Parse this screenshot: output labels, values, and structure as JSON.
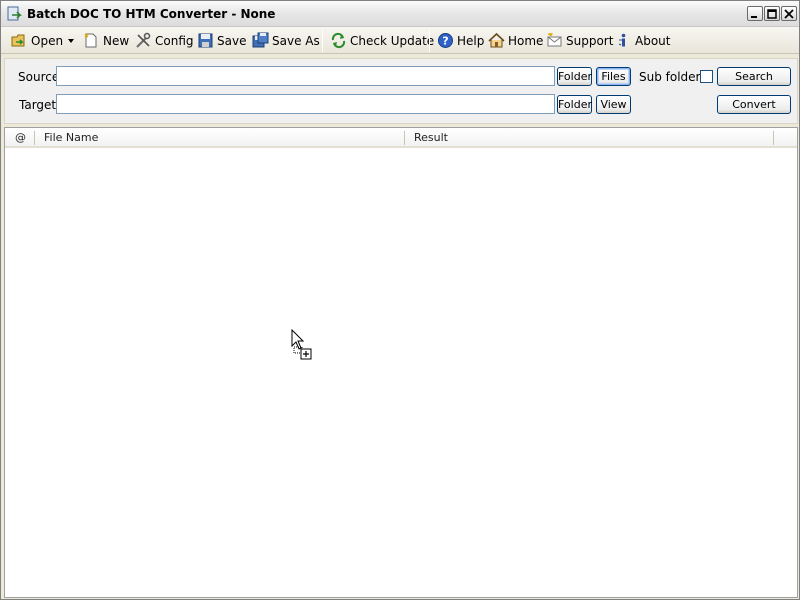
{
  "window": {
    "title": "Batch DOC TO HTM Converter - None"
  },
  "toolbar": {
    "open": "Open",
    "new": "New",
    "config": "Config",
    "save": "Save",
    "save_as": "Save As",
    "check_update": "Check Update",
    "help": "Help",
    "home": "Home",
    "support": "Support",
    "about": "About"
  },
  "form": {
    "source_label": "Source",
    "source_value": "",
    "target_label": "Target",
    "target_value": "",
    "folder_label": "Folder",
    "files_label": "Files",
    "view_label": "View",
    "subfolders_label": "Sub folders",
    "search_label": "Search",
    "convert_label": "Convert"
  },
  "list": {
    "columns": [
      "@",
      "File Name",
      "Result"
    ],
    "rows": []
  },
  "colors": {
    "input_border": "#7f9db9",
    "button_border": "#003c74"
  }
}
